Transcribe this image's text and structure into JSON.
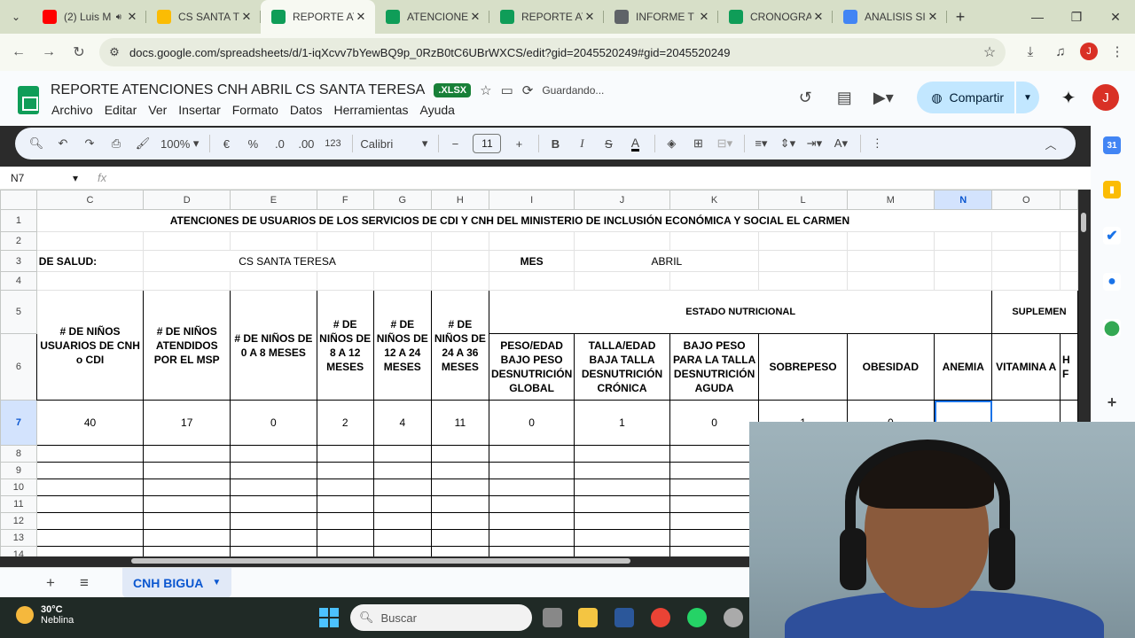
{
  "browser": {
    "tabs": [
      {
        "title": "(2) Luis M",
        "icon": "youtube-icon",
        "color": "#ff0000",
        "sound": true,
        "active": false
      },
      {
        "title": "CS SANTA TE",
        "icon": "drive-icon",
        "color": "#fbbc04",
        "active": false
      },
      {
        "title": "REPORTE AT",
        "icon": "sheets-icon",
        "color": "#0f9d58",
        "active": true
      },
      {
        "title": "ATENCIONE",
        "icon": "sheets-icon",
        "color": "#0f9d58",
        "active": false
      },
      {
        "title": "REPORTE AT",
        "icon": "sheets-icon",
        "color": "#0f9d58",
        "active": false
      },
      {
        "title": "INFORME T",
        "icon": "globe-icon",
        "color": "#5f6368",
        "active": false
      },
      {
        "title": "CRONOGRA",
        "icon": "sheets-icon",
        "color": "#0f9d58",
        "active": false
      },
      {
        "title": "ANALISIS SI",
        "icon": "docs-icon",
        "color": "#4285f4",
        "active": false
      }
    ],
    "url": "docs.google.com/spreadsheets/d/1-iqXcvv7bYewBQ9p_0RzB0tC6UBrWXCS/edit?gid=2045520249#gid=2045520249",
    "avatar_letter": "J"
  },
  "sheets": {
    "title": "REPORTE ATENCIONES CNH ABRIL CS SANTA TERESA",
    "file_badge": ".XLSX",
    "saving_status": "Guardando...",
    "menu": [
      "Archivo",
      "Editar",
      "Ver",
      "Insertar",
      "Formato",
      "Datos",
      "Herramientas",
      "Ayuda"
    ],
    "share_label": "Compartir",
    "avatar_letter": "J",
    "toolbar": {
      "zoom": "100%",
      "currency": "€",
      "percent": "%",
      "dec_minus": ".0",
      "dec_plus": ".00",
      "number_format": "123",
      "font": "Calibri",
      "font_size": "11"
    },
    "name_box": "N7",
    "fx": "fx",
    "columns": [
      "C",
      "D",
      "E",
      "F",
      "G",
      "H",
      "I",
      "J",
      "K",
      "L",
      "M",
      "N",
      "O"
    ],
    "selected_column": "N",
    "rows": [
      "1",
      "2",
      "3",
      "4",
      "5",
      "6",
      "7",
      "8",
      "9",
      "10",
      "11",
      "12",
      "13",
      "14"
    ],
    "selected_row": "7",
    "report_title": "ATENCIONES DE USUARIOS DE LOS SERVICIOS DE CDI Y CNH DEL MINISTERIO DE INCLUSIÓN ECONÓMICA Y SOCIAL EL CARMEN",
    "row3": {
      "label": "DE SALUD:",
      "unit": "CS SANTA TERESA",
      "mes_label": "MES",
      "mes_value": "ABRIL"
    },
    "estado_nutricional": "ESTADO NUTRICIONAL",
    "suplementacion": "SUPLEMEN",
    "headers": {
      "C": "# DE NIÑOS USUARIOS DE CNH o CDI",
      "D": "# DE NIÑOS ATENDIDOS POR EL MSP",
      "E": "# DE NIÑOS DE 0 A 8 MESES",
      "F": "# DE NIÑOS DE 8 A 12 MESES",
      "G": "# DE NIÑOS DE 12 A 24 MESES",
      "H": "# DE NIÑOS DE 24 A 36 MESES",
      "I": "PESO/EDAD BAJO PESO DESNUTRICIÓN GLOBAL",
      "J": "TALLA/EDAD BAJA TALLA DESNUTRICIÓN CRÓNICA",
      "K": "BAJO PESO PARA LA TALLA DESNUTRICIÓN AGUDA",
      "L": "SOBREPESO",
      "M": "OBESIDAD",
      "N": "ANEMIA",
      "O": "VITAMINA A",
      "P": "H F"
    },
    "values": {
      "C": "40",
      "D": "17",
      "E": "0",
      "F": "2",
      "G": "4",
      "H": "11",
      "I": "0",
      "J": "1",
      "K": "0",
      "L": "1",
      "M": "0",
      "N": "",
      "O": ""
    },
    "sheet_tab": "CNH BIGUA"
  },
  "taskbar": {
    "temperature": "30°C",
    "weather": "Neblina",
    "search_placeholder": "Buscar"
  }
}
